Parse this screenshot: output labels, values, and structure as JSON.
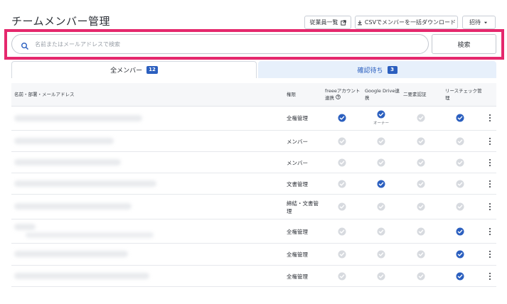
{
  "header": {
    "title": "チームメンバー管理",
    "staff_list_label": "従業員一覧",
    "csv_label": "CSVでメンバーを一括ダウンロード",
    "invite_label": "招待"
  },
  "search": {
    "placeholder": "名前またはメールアドレスで検索",
    "value": "",
    "button_label": "検索"
  },
  "tabs": [
    {
      "label": "全メンバー",
      "count": "12",
      "active": true
    },
    {
      "label": "確認待ち",
      "count": "3",
      "active": false
    }
  ],
  "table": {
    "columns": {
      "name": "名前・部署・メールアドレス",
      "role": "権限",
      "freee": "freeeアカウント連携",
      "gdrive": "Google Drive連携",
      "twofa": "二要素認証",
      "risk": "リースチェック管理"
    },
    "owner_label": "オーナー",
    "rows": [
      {
        "role": "全権管理",
        "freee": true,
        "gdrive": true,
        "gdrive_owner": true,
        "twofa": false,
        "risk": true
      },
      {
        "role": "メンバー",
        "freee": false,
        "gdrive": false,
        "gdrive_owner": false,
        "twofa": false,
        "risk": false
      },
      {
        "role": "メンバー",
        "freee": false,
        "gdrive": false,
        "gdrive_owner": false,
        "twofa": false,
        "risk": false
      },
      {
        "role": "文書管理",
        "freee": false,
        "gdrive": true,
        "gdrive_owner": false,
        "twofa": false,
        "risk": false
      },
      {
        "role": "締結・文書管理",
        "freee": false,
        "gdrive": false,
        "gdrive_owner": false,
        "twofa": false,
        "risk": false
      },
      {
        "role": "全権管理",
        "freee": false,
        "gdrive": false,
        "gdrive_owner": false,
        "twofa": false,
        "risk": true
      },
      {
        "role": "全権管理",
        "freee": false,
        "gdrive": false,
        "gdrive_owner": false,
        "twofa": false,
        "risk": true
      },
      {
        "role": "全権管理",
        "freee": false,
        "gdrive": false,
        "gdrive_owner": false,
        "twofa": false,
        "risk": true
      }
    ]
  },
  "colors": {
    "accent": "#2b5fbf",
    "check_on": "#2b5fbf",
    "check_off": "#d7dadf",
    "highlight": "#e5286d"
  },
  "icons": {
    "search": "search-icon",
    "external": "external-link-icon",
    "download": "download-icon",
    "caret": "caret-down-icon",
    "check": "check-circle-icon",
    "more": "more-vertical-icon",
    "help": "help-circle-icon"
  }
}
